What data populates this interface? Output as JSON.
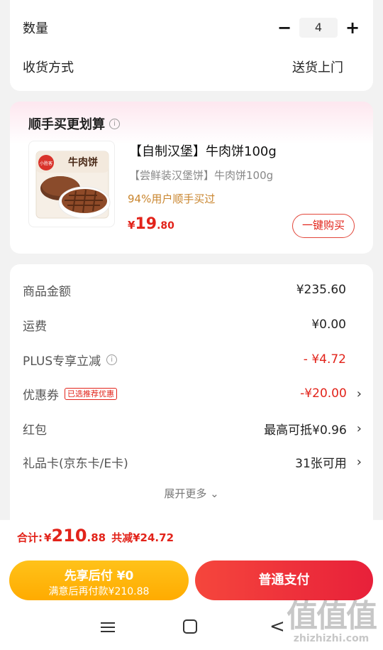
{
  "order": {
    "quantity_label": "数量",
    "quantity_minus": "−",
    "quantity_value": "4",
    "quantity_plus": "+",
    "delivery_label": "收货方式",
    "delivery_value": "送货上门"
  },
  "bundle": {
    "title": "顺手买更划算",
    "info_glyph": "i",
    "product": {
      "name": "【自制汉堡】牛肉饼100g",
      "subtitle": "【尝鲜装汉堡饼】牛肉饼100g",
      "popularity": "94%用户顺手买过",
      "price_currency": "¥",
      "price_int": "19",
      "price_dec": ".80",
      "buy_button": "一键购买",
      "package_brand": "小胜客",
      "package_text": "牛肉饼"
    }
  },
  "summary": {
    "rows": [
      {
        "label": "商品金额",
        "value": "¥235.60"
      },
      {
        "label": "运费",
        "value": "¥0.00"
      },
      {
        "label": "PLUS专享立减",
        "value": "- ¥4.72"
      },
      {
        "label": "优惠券",
        "tag": "已选推荐优惠",
        "value": "-¥20.00"
      },
      {
        "label": "红包",
        "value": "最高可抵¥0.96"
      },
      {
        "label": "礼品卡(京东卡/E卡)",
        "value": "31张可用"
      }
    ],
    "chevron": "›",
    "expand_label": "展开更多 ⌄"
  },
  "total": {
    "label": "合计:",
    "currency": "¥",
    "int": "210",
    "dec": ".88",
    "saving": "共减¥24.72"
  },
  "actions": {
    "pay_later_title": "先享后付 ¥0",
    "pay_later_sub": "满意后再付款¥210.88",
    "pay_normal": "普通支付"
  },
  "nav": {
    "back_glyph": "<"
  },
  "watermark": {
    "big": "值值值",
    "small": "zhizhizhi.com"
  },
  "colors": {
    "accent_red": "#e2231a",
    "pay_later_yellow": "#ffb400",
    "popularity_gold": "#c9852e"
  }
}
